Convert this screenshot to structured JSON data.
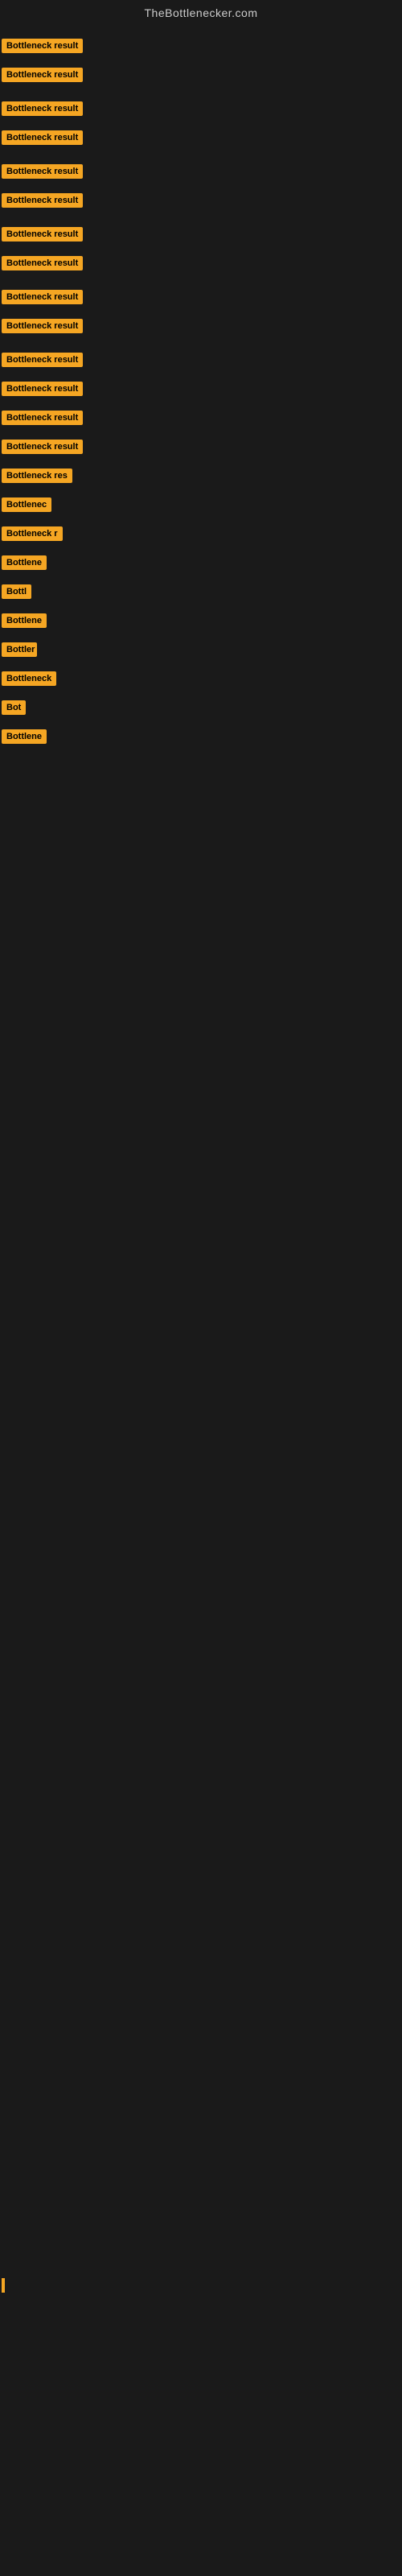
{
  "site": {
    "title": "TheBottlenecker.com"
  },
  "items": [
    {
      "id": 0,
      "label": "Bottleneck result",
      "width": "full",
      "marginLeft": 2
    },
    {
      "id": 1,
      "label": "Bottleneck result",
      "width": "full",
      "marginLeft": 2
    },
    {
      "id": 2,
      "label": "Bottleneck result",
      "width": "full",
      "marginLeft": 2
    },
    {
      "id": 3,
      "label": "Bottleneck result",
      "width": "full",
      "marginLeft": 2
    },
    {
      "id": 4,
      "label": "Bottleneck result",
      "width": "full",
      "marginLeft": 2
    },
    {
      "id": 5,
      "label": "Bottleneck result",
      "width": "full",
      "marginLeft": 2
    },
    {
      "id": 6,
      "label": "Bottleneck result",
      "width": "full",
      "marginLeft": 2
    },
    {
      "id": 7,
      "label": "Bottleneck result",
      "width": "full",
      "marginLeft": 2
    },
    {
      "id": 8,
      "label": "Bottleneck result",
      "width": "full",
      "marginLeft": 2
    },
    {
      "id": 9,
      "label": "Bottleneck result",
      "width": "full",
      "marginLeft": 2
    },
    {
      "id": 10,
      "label": "Bottleneck result",
      "width": "full",
      "marginLeft": 2
    },
    {
      "id": 11,
      "label": "Bottleneck result",
      "width": "full",
      "marginLeft": 2
    },
    {
      "id": 12,
      "label": "Bottleneck result",
      "width": "full",
      "marginLeft": 2
    },
    {
      "id": 13,
      "label": "Bottleneck result",
      "width": "full",
      "marginLeft": 2
    },
    {
      "id": 14,
      "label": "Bottleneck res",
      "width": "partial1",
      "marginLeft": 2
    },
    {
      "id": 15,
      "label": "Bottlenec",
      "width": "partial2",
      "marginLeft": 2
    },
    {
      "id": 16,
      "label": "Bottleneck r",
      "width": "partial3",
      "marginLeft": 2
    },
    {
      "id": 17,
      "label": "Bottlene",
      "width": "partial2",
      "marginLeft": 2
    },
    {
      "id": 18,
      "label": "Bottl",
      "width": "partial4",
      "marginLeft": 2
    },
    {
      "id": 19,
      "label": "Bottlene",
      "width": "partial2",
      "marginLeft": 2
    },
    {
      "id": 20,
      "label": "Bottler",
      "width": "partial4",
      "marginLeft": 2
    },
    {
      "id": 21,
      "label": "Bottleneck",
      "width": "partial3",
      "marginLeft": 2
    },
    {
      "id": 22,
      "label": "Bot",
      "width": "partial5",
      "marginLeft": 2
    },
    {
      "id": 23,
      "label": "Bottlene",
      "width": "partial2",
      "marginLeft": 2
    }
  ]
}
